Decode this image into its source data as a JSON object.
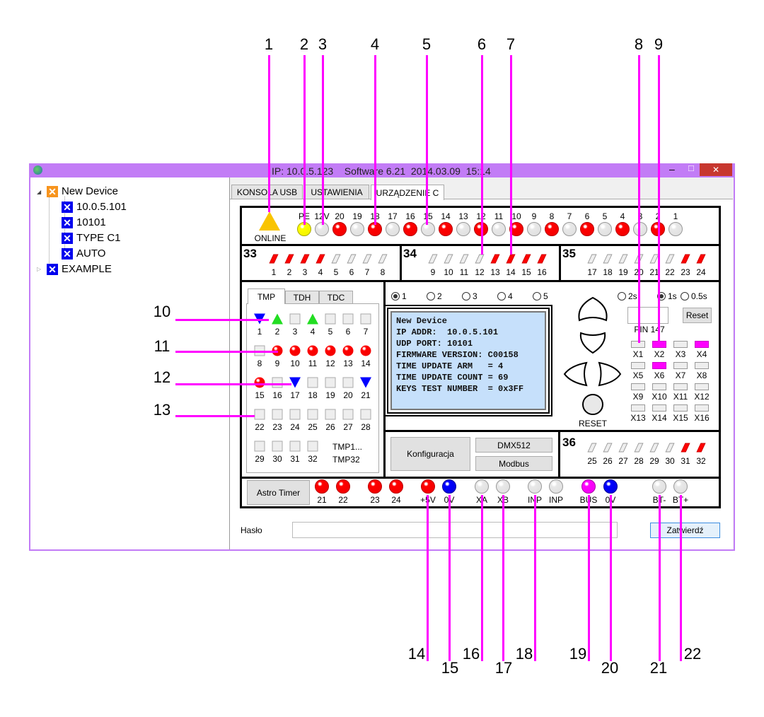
{
  "window": {
    "title": "IP: 10.0.5.123    Software 6.21  2014.03.09  15:14",
    "controls": {
      "minimize": "–",
      "maximize": "□",
      "close": "✕"
    }
  },
  "tree": {
    "root": "New Device",
    "children": [
      "10.0.5.101",
      "10101",
      "TYPE C1",
      "AUTO"
    ],
    "second": "EXAMPLE"
  },
  "tabs": [
    "KONSOLA USB",
    "USTAWIENIA",
    "URZĄDZENIE C"
  ],
  "online_label": "ONLINE",
  "top_leds": [
    {
      "label": "PE",
      "state": "yellow"
    },
    {
      "label": "12V",
      "state": "off"
    },
    {
      "label": "20",
      "state": "red"
    },
    {
      "label": "19",
      "state": "off"
    },
    {
      "label": "18",
      "state": "red"
    },
    {
      "label": "17",
      "state": "off"
    },
    {
      "label": "16",
      "state": "red"
    },
    {
      "label": "15",
      "state": "off"
    },
    {
      "label": "14",
      "state": "red"
    },
    {
      "label": "13",
      "state": "off"
    },
    {
      "label": "12",
      "state": "red"
    },
    {
      "label": "11",
      "state": "off"
    },
    {
      "label": "10",
      "state": "red"
    },
    {
      "label": "9",
      "state": "off"
    },
    {
      "label": "8",
      "state": "red"
    },
    {
      "label": "7",
      "state": "off"
    },
    {
      "label": "6",
      "state": "red"
    },
    {
      "label": "5",
      "state": "off"
    },
    {
      "label": "4",
      "state": "red"
    },
    {
      "label": "3",
      "state": "off"
    },
    {
      "label": "2",
      "state": "red"
    },
    {
      "label": "1",
      "state": "off"
    }
  ],
  "slots": [
    {
      "name": "33",
      "items": [
        {
          "n": "1",
          "on": true
        },
        {
          "n": "2",
          "on": true
        },
        {
          "n": "3",
          "on": true
        },
        {
          "n": "4",
          "on": true
        },
        {
          "n": "5",
          "on": false
        },
        {
          "n": "6",
          "on": false
        },
        {
          "n": "7",
          "on": false
        },
        {
          "n": "8",
          "on": false
        }
      ]
    },
    {
      "name": "34",
      "items": [
        {
          "n": "9",
          "on": false
        },
        {
          "n": "10",
          "on": false
        },
        {
          "n": "11",
          "on": false
        },
        {
          "n": "12",
          "on": false
        },
        {
          "n": "13",
          "on": true
        },
        {
          "n": "14",
          "on": true
        },
        {
          "n": "15",
          "on": true
        },
        {
          "n": "16",
          "on": true
        }
      ]
    },
    {
      "name": "35",
      "items": [
        {
          "n": "17",
          "on": false
        },
        {
          "n": "18",
          "on": false
        },
        {
          "n": "19",
          "on": false
        },
        {
          "n": "20",
          "on": false
        },
        {
          "n": "21",
          "on": false
        },
        {
          "n": "22",
          "on": false
        },
        {
          "n": "23",
          "on": true
        },
        {
          "n": "24",
          "on": true
        }
      ]
    },
    {
      "name": "36",
      "items": [
        {
          "n": "25",
          "on": false
        },
        {
          "n": "26",
          "on": false
        },
        {
          "n": "27",
          "on": false
        },
        {
          "n": "28",
          "on": false
        },
        {
          "n": "29",
          "on": false
        },
        {
          "n": "30",
          "on": false
        },
        {
          "n": "31",
          "on": true
        },
        {
          "n": "32",
          "on": true
        }
      ]
    }
  ],
  "tmp": {
    "tabs": [
      "TMP",
      "TDH",
      "TDC"
    ],
    "caption": [
      "TMP1...",
      "TMP32"
    ],
    "states": [
      "down",
      "up",
      "off",
      "up",
      "off",
      "off",
      "off",
      "off",
      "red",
      "red",
      "red",
      "red",
      "red",
      "red",
      "red",
      "off",
      "down",
      "off",
      "off",
      "off",
      "down",
      "off",
      "off",
      "off",
      "off",
      "off",
      "off",
      "off",
      "off",
      "off",
      "off",
      "off"
    ]
  },
  "screens": {
    "options": [
      "1",
      "2",
      "3",
      "4",
      "5"
    ],
    "selected": "1"
  },
  "lcd": [
    "New Device",
    "IP ADDR:  10.0.5.101",
    "UDP PORT: 10101",
    "FIRMWARE VERSION: C00158",
    "TIME UPDATE ARM   = 4",
    "TIME UPDATE COUNT = 69",
    "KEYS TEST NUMBER  = 0x3FF"
  ],
  "reset_label": "RESET",
  "interval": {
    "options": [
      "2s",
      "1s",
      "0.5s"
    ],
    "selected": "1s"
  },
  "pin": {
    "value": "",
    "label": "PIN 147",
    "reset": "Reset"
  },
  "outputs": [
    {
      "label": "X1",
      "on": false
    },
    {
      "label": "X2",
      "on": true
    },
    {
      "label": "X3",
      "on": false
    },
    {
      "label": "X4",
      "on": true
    },
    {
      "label": "X5",
      "on": false
    },
    {
      "label": "X6",
      "on": true
    },
    {
      "label": "X7",
      "on": false
    },
    {
      "label": "X8",
      "on": false
    },
    {
      "label": "X9",
      "on": false
    },
    {
      "label": "X10",
      "on": false
    },
    {
      "label": "X11",
      "on": false
    },
    {
      "label": "X12",
      "on": false
    },
    {
      "label": "X13",
      "on": false
    },
    {
      "label": "X14",
      "on": false
    },
    {
      "label": "X15",
      "on": false
    },
    {
      "label": "X16",
      "on": false
    }
  ],
  "buttons": {
    "config": "Konfiguracja",
    "dmx": "DMX512",
    "modbus": "Modbus",
    "astro": "Astro Timer",
    "submit": "Zatwierdź"
  },
  "bottom_leds": [
    {
      "label": "21",
      "state": "red"
    },
    {
      "label": "22",
      "state": "red"
    },
    {
      "label": "23",
      "state": "red"
    },
    {
      "label": "24",
      "state": "red"
    },
    {
      "label": "+5V",
      "state": "red"
    },
    {
      "label": "0V",
      "state": "blue"
    },
    {
      "label": "XA",
      "state": "off"
    },
    {
      "label": "XB",
      "state": "off"
    },
    {
      "label": "INP",
      "state": "off"
    },
    {
      "label": "INP",
      "state": "off"
    },
    {
      "label": "BUS",
      "state": "magenta"
    },
    {
      "label": "0V",
      "state": "blue"
    },
    {
      "label": "BT-",
      "state": "off"
    },
    {
      "label": "BT+",
      "state": "off"
    }
  ],
  "password": {
    "label": "Hasło",
    "value": ""
  },
  "callouts": [
    "1",
    "2",
    "3",
    "4",
    "5",
    "6",
    "7",
    "8",
    "9",
    "10",
    "11",
    "12",
    "13",
    "14",
    "15",
    "16",
    "17",
    "18",
    "19",
    "20",
    "21",
    "22"
  ],
  "colors": {
    "titlebar": "#c27cf6",
    "callout": "#ff00ff",
    "lcd": "#c6e0fb"
  }
}
